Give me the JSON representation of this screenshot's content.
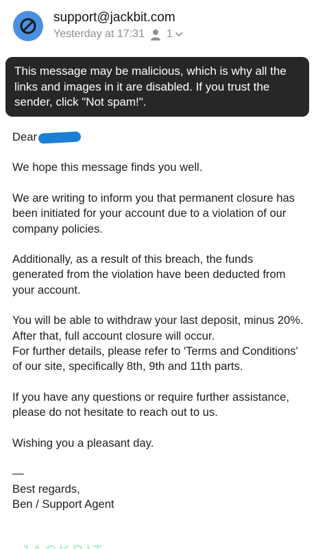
{
  "header": {
    "sender": "support@jackbit.com",
    "timestamp": "Yesterday at 17:31",
    "recipients_count": "1",
    "avatar_color": "#4a90e2",
    "icons": {
      "avatar": "blocked-icon",
      "recipient": "person-icon",
      "expand": "chevron-down-icon"
    }
  },
  "warning": {
    "text": "This message may be malicious, which is why all the links and images in it are disabled. If you trust the sender, click \"Not spam!\"."
  },
  "email": {
    "greeting": "Dear",
    "paragraphs": [
      "We hope this message finds you well.",
      "We are writing to inform you that permanent closure has been initiated for your account due to a violation of our company policies.",
      "Additionally, as a result of this breach, the funds generated from the violation have been deducted from your account.",
      "You will be able to withdraw your last deposit, minus 20%. After that, full account closure will occur.",
      "For further details, please refer to 'Terms and Conditions' of our site, specifically 8th, 9th and 11th parts.",
      "If you have any questions or require further assistance, please do not hesitate to reach out to us.",
      "Wishing you a pleasant day."
    ],
    "signoff_dash": "—",
    "signoff": "Best regards,",
    "signature": "Ben / Support Agent"
  },
  "footer_logo_fragment": "JACKBIT"
}
